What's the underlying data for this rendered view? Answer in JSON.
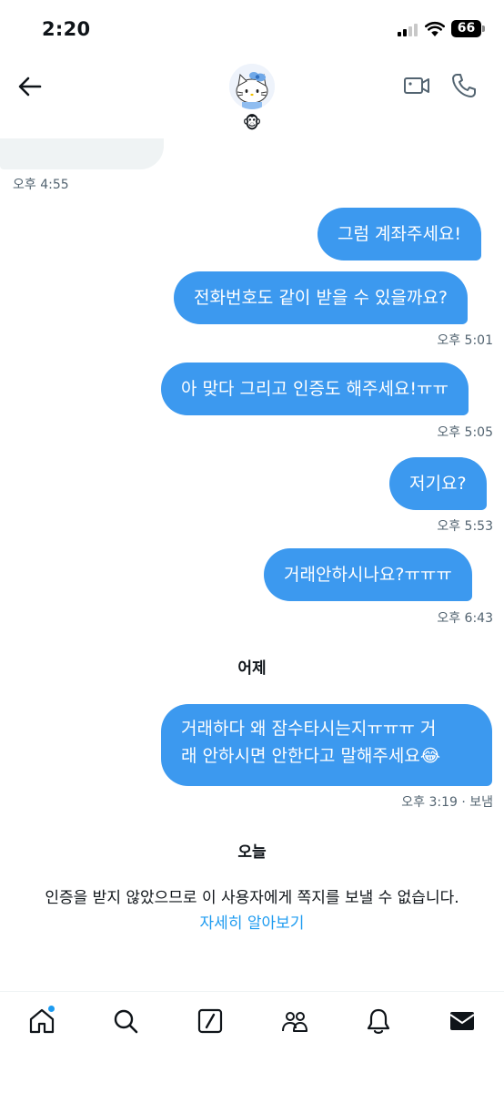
{
  "status_bar": {
    "time": "2:20",
    "battery": "66"
  },
  "header": {
    "avatar_icon": "hello-kitty-avatar",
    "name_emoji": "🐵"
  },
  "messages": {
    "received_timestamp": "오후 4:55",
    "sent": [
      {
        "text": "그럼 계좌주세요!"
      },
      {
        "text": "전화번호도 같이 받을 수 있을까요?",
        "timestamp": "오후 5:01"
      },
      {
        "text": "아 맞다 그리고 인증도 해주세요!ㅠㅠ",
        "timestamp": "오후 5:05"
      },
      {
        "text": "저기요?",
        "timestamp": "오후 5:53"
      },
      {
        "text": "거래안하시나요?ㅠㅠㅠ",
        "timestamp": "오후 6:43"
      }
    ],
    "day_yesterday": "어제",
    "yesterday_message": {
      "line1": "거래하다 왜 잠수타시는지ㅠㅠㅠ 거",
      "line2": "래 안하시면 안한다고 말해주세요😂",
      "timestamp": "오후 3:19 · 보냄"
    },
    "day_today": "오늘"
  },
  "notice": {
    "text": "인증을 받지 않았으므로 이 사용자에게 쪽지를 보낼 수 없습니다.",
    "link": "자세히 알아보기"
  },
  "colors": {
    "bubble": "#3c99ef",
    "link": "#1d9bf0",
    "timestamp": "#536471"
  },
  "bottom_nav": [
    "home-icon",
    "search-icon",
    "grok-icon",
    "communities-icon",
    "notifications-icon",
    "messages-icon"
  ]
}
